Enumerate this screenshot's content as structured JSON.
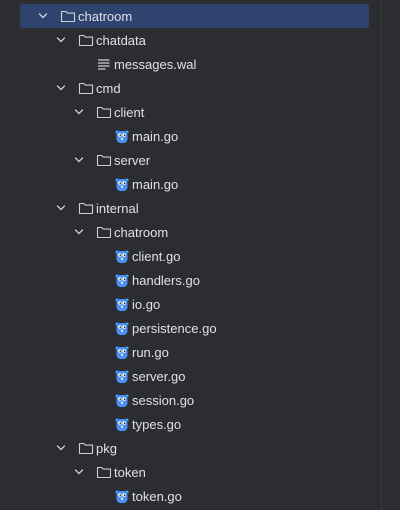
{
  "tree": {
    "items": [
      {
        "label": "chatroom",
        "type": "folder",
        "depth": 0,
        "expanded": true,
        "selected": true
      },
      {
        "label": "chatdata",
        "type": "folder",
        "depth": 1,
        "expanded": true
      },
      {
        "label": "messages.wal",
        "type": "text-file",
        "depth": 2
      },
      {
        "label": "cmd",
        "type": "folder",
        "depth": 1,
        "expanded": true
      },
      {
        "label": "client",
        "type": "folder",
        "depth": 2,
        "expanded": true
      },
      {
        "label": "main.go",
        "type": "go-file",
        "depth": 3
      },
      {
        "label": "server",
        "type": "folder",
        "depth": 2,
        "expanded": true
      },
      {
        "label": "main.go",
        "type": "go-file",
        "depth": 3
      },
      {
        "label": "internal",
        "type": "folder",
        "depth": 1,
        "expanded": true
      },
      {
        "label": "chatroom",
        "type": "folder",
        "depth": 2,
        "expanded": true
      },
      {
        "label": "client.go",
        "type": "go-file",
        "depth": 3
      },
      {
        "label": "handlers.go",
        "type": "go-file",
        "depth": 3
      },
      {
        "label": "io.go",
        "type": "go-file",
        "depth": 3
      },
      {
        "label": "persistence.go",
        "type": "go-file",
        "depth": 3
      },
      {
        "label": "run.go",
        "type": "go-file",
        "depth": 3
      },
      {
        "label": "server.go",
        "type": "go-file",
        "depth": 3
      },
      {
        "label": "session.go",
        "type": "go-file",
        "depth": 3
      },
      {
        "label": "types.go",
        "type": "go-file",
        "depth": 3
      },
      {
        "label": "pkg",
        "type": "folder",
        "depth": 1,
        "expanded": true
      },
      {
        "label": "token",
        "type": "folder",
        "depth": 2,
        "expanded": true
      },
      {
        "label": "token.go",
        "type": "go-file",
        "depth": 3
      }
    ]
  },
  "colors": {
    "background": "#2b2d30",
    "selection": "#2e436e",
    "text": "#dfe1e5",
    "folder_icon": "#ced0d6",
    "gopher_icon": "#4c8ff5"
  }
}
